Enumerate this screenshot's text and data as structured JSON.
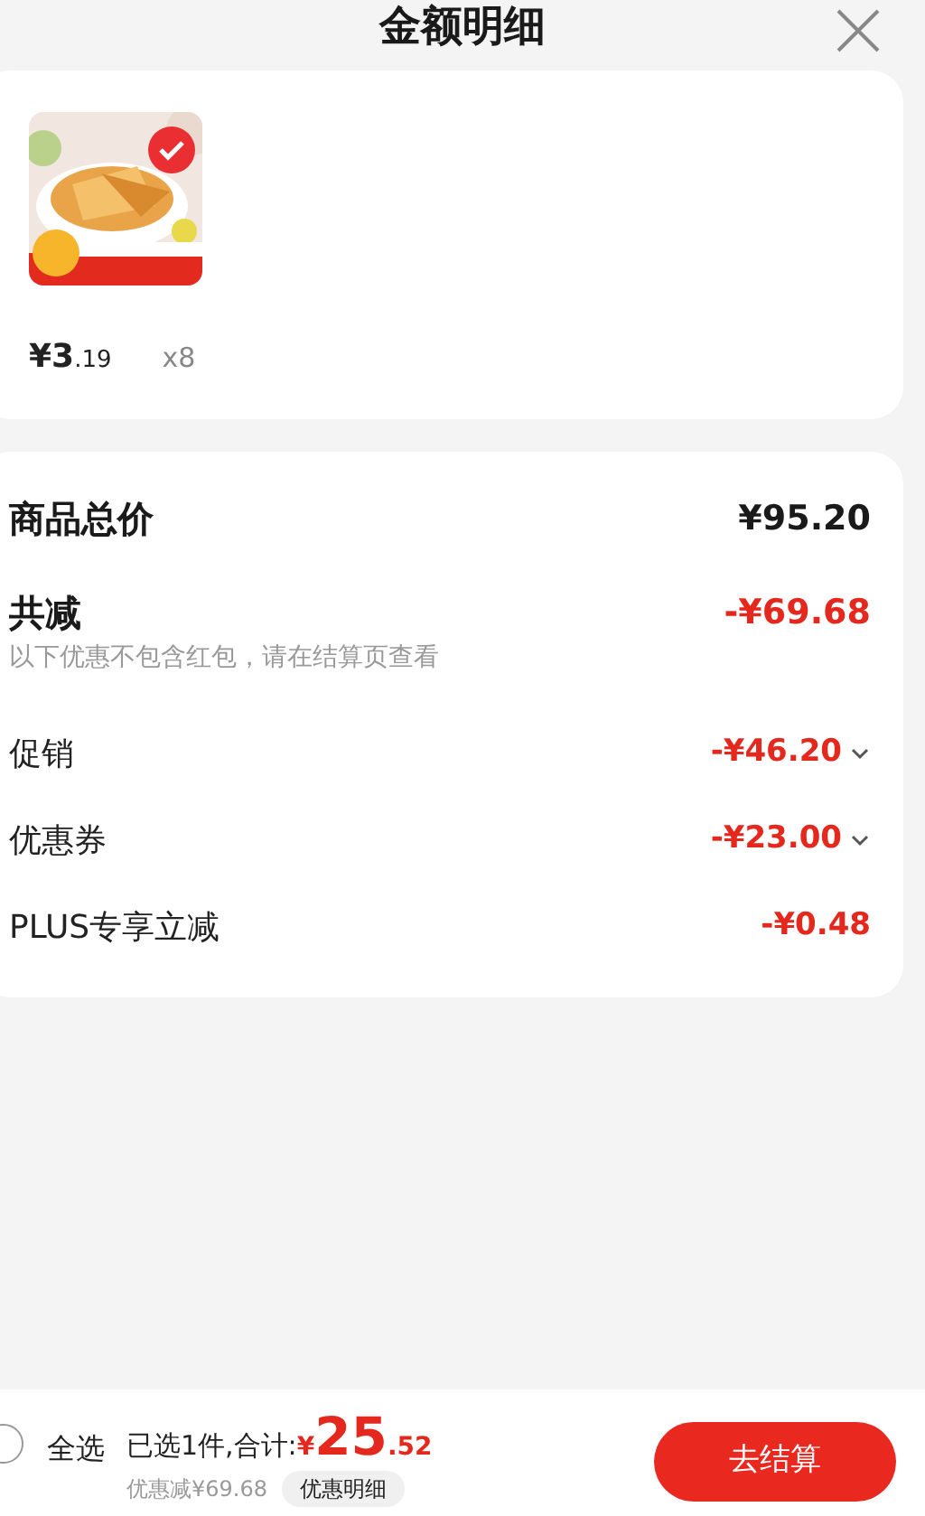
{
  "header": {
    "title": "金额明细"
  },
  "product": {
    "kind": "picture",
    "selected": true,
    "price": "¥3.19",
    "quantity": "x8"
  },
  "summary": [
    {
      "kind": "total",
      "label": "商品总价",
      "amount": "¥95.20"
    },
    {
      "kind": "reduction",
      "label": "共减",
      "amount": "-¥69.68",
      "note": "以下优惠不包含红包，请在结算页查看"
    },
    {
      "kind": "dropdown",
      "label": "促销",
      "amount": "-¥46.20"
    },
    {
      "kind": "dropdown",
      "label": "优惠券",
      "amount": "-¥23.00"
    },
    {
      "kind": "item",
      "label": "PLUS专享立减",
      "amount": "-¥0.48"
    }
  ],
  "footer": {
    "select_all": {
      "label": "全选",
      "checked": false
    },
    "selected_text": "已选1件,合计:",
    "total": "¥25.52",
    "saved": "优惠减¥69.68",
    "details_button": "优惠明细",
    "checkout_button": "去结算"
  }
}
